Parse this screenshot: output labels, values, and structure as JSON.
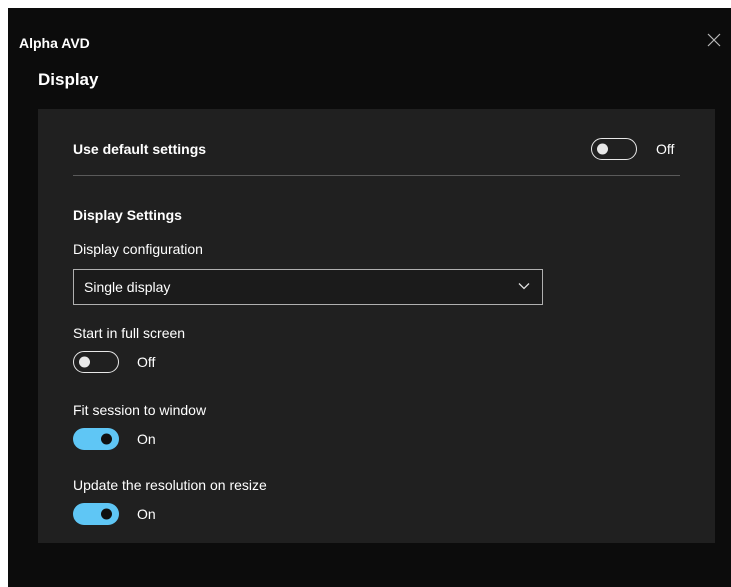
{
  "window": {
    "app_title": "Alpha AVD",
    "close_icon": "close-icon"
  },
  "page": {
    "title": "Display"
  },
  "default_settings": {
    "label": "Use default settings",
    "state_label": "Off",
    "enabled": false
  },
  "display_settings": {
    "heading": "Display Settings",
    "configuration": {
      "label": "Display configuration",
      "value": "Single display",
      "chevron_icon": "chevron-down-icon"
    },
    "full_screen": {
      "label": "Start in full screen",
      "state_label": "Off",
      "enabled": false
    },
    "fit_session": {
      "label": "Fit session to window",
      "state_label": "On",
      "enabled": true
    },
    "update_resolution": {
      "label": "Update the resolution on resize",
      "state_label": "On",
      "enabled": true
    }
  },
  "colors": {
    "window_background": "#0c0c0c",
    "panel_background": "#202020",
    "toggle_on_accent": "#5fc6f5",
    "text": "#ffffff"
  }
}
